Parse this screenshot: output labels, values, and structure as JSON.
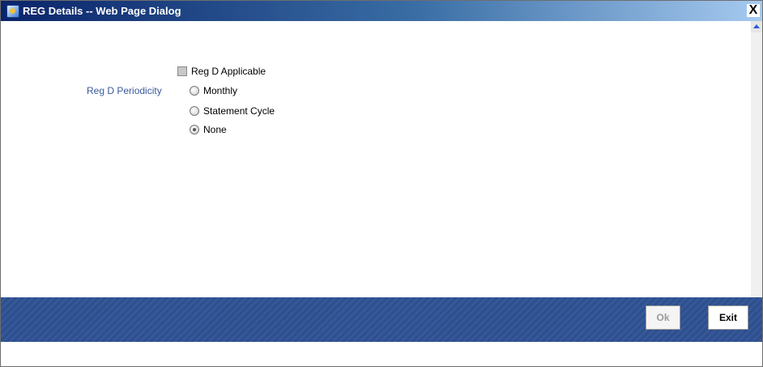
{
  "window": {
    "title": "REG Details -- Web Page Dialog",
    "close_label": "X"
  },
  "form": {
    "checkbox_label": "Reg D Applicable",
    "periodicity_label": "Reg D Periodicity",
    "options": [
      {
        "label": "Monthly",
        "checked": false
      },
      {
        "label": "Statement Cycle",
        "checked": false
      },
      {
        "label": "None",
        "checked": true
      }
    ]
  },
  "footer": {
    "ok_label": "Ok",
    "exit_label": "Exit"
  },
  "colors": {
    "titlebar": "#0a246a",
    "footer": "#2e4f8c",
    "field_label": "#3a5a9a"
  }
}
